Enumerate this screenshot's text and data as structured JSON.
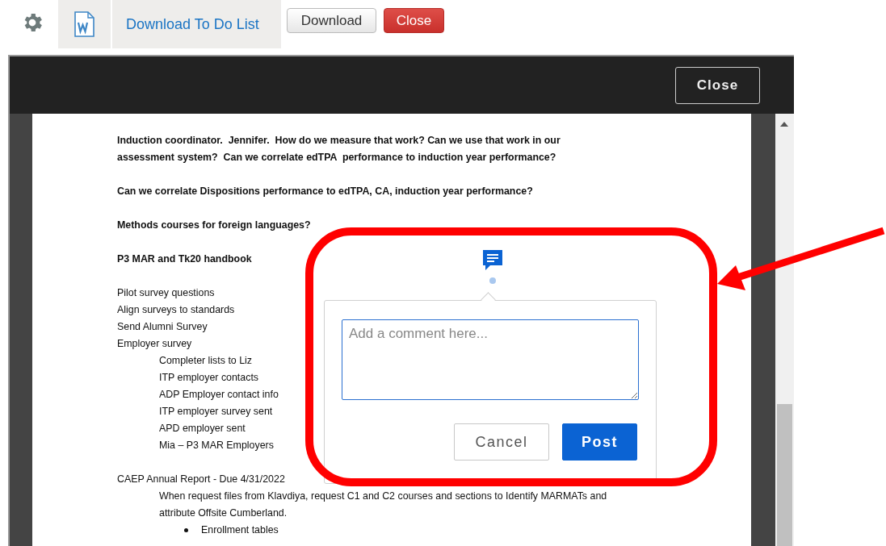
{
  "toolbar": {
    "link": "Download To Do List",
    "buttons": [
      {
        "label": "Download",
        "kind": "default"
      },
      {
        "label": "Close",
        "kind": "danger"
      }
    ]
  },
  "viewer": {
    "close": "Close",
    "blocks": [
      {
        "kind": "paragraph",
        "bold": true,
        "text": "Induction coordinator.  Jennifer.  How do we measure that work? Can we use that work in our assessment system?  Can we correlate edTPA  performance to induction year performance?"
      },
      {
        "kind": "paragraph",
        "bold": true,
        "text": "Can we correlate Dispositions performance to edTPA, CA, induction year performance?"
      },
      {
        "kind": "paragraph",
        "bold": true,
        "text": "Methods courses for foreign languages?"
      },
      {
        "kind": "paragraph",
        "bold": true,
        "text": "P3 MAR and Tk20 handbook"
      },
      {
        "kind": "list",
        "items": [
          {
            "text": "Pilot survey questions"
          },
          {
            "text": "Align surveys to standards"
          },
          {
            "text": "Send Alumni Survey"
          },
          {
            "text": "Employer survey",
            "children": [
              {
                "text": "Completer lists to Liz"
              },
              {
                "text": "ITP employer contacts"
              },
              {
                "text": "ADP Employer contact info"
              },
              {
                "text": "ITP employer survey sent"
              },
              {
                "text": "APD employer sent"
              },
              {
                "text": "Mia – P3 MAR Employers"
              }
            ]
          }
        ]
      },
      {
        "kind": "list",
        "items": [
          {
            "text": "CAEP Annual Report - Due 4/31/2022",
            "children": [
              {
                "text": "When request files from Klavdiya, request C1 and C2 courses and sections to Identify MARMATs and attribute Offsite Cumberland.",
                "children": [
                  {
                    "text": "Enrollment tables",
                    "bullet": true
                  }
                ]
              }
            ]
          }
        ]
      }
    ]
  },
  "comment": {
    "placeholder": "Add a comment here...",
    "buttons": [
      {
        "label": "Cancel",
        "kind": "secondary"
      },
      {
        "label": "Post",
        "kind": "primary"
      }
    ]
  }
}
